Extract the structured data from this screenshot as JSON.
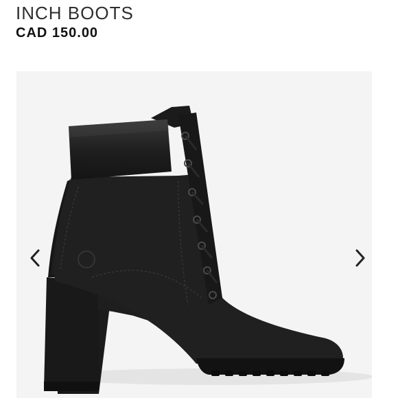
{
  "product": {
    "title": "INCH BOOTS",
    "price": "CAD 150.00"
  },
  "gallery": {
    "image_subject": "black nubuck lace-up high-heel ankle boot",
    "prev_icon": "chevron-left-icon",
    "next_icon": "chevron-right-icon"
  },
  "colors": {
    "background": "#ffffff",
    "gallery_background": "#f4f4f4",
    "boot": "#1c1c1c",
    "text": "#2e2e2e"
  }
}
